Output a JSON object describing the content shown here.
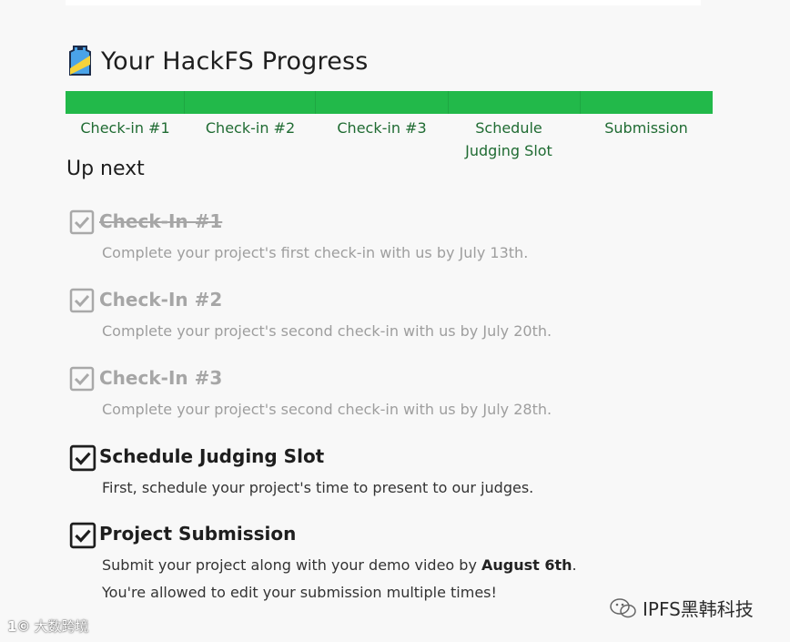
{
  "header": {
    "title": "Your HackFS Progress",
    "icon": "building-badge-icon"
  },
  "progress": {
    "steps": [
      {
        "label": "Check-in #1",
        "complete": true
      },
      {
        "label": "Check-in #2",
        "complete": true
      },
      {
        "label": "Check-in #3",
        "complete": true
      },
      {
        "label": "Schedule Judging Slot",
        "complete": true
      },
      {
        "label": "Submission",
        "complete": true
      }
    ],
    "color": "#22b94a"
  },
  "upnext": {
    "heading": "Up next"
  },
  "tasks": [
    {
      "title": "Check-In #1",
      "desc": "Complete your project's first check-in with us by July 13th.",
      "state": "done-struck"
    },
    {
      "title": "Check-In #2",
      "desc": "Complete your project's second check-in with us by July 20th.",
      "state": "done"
    },
    {
      "title": "Check-In #3",
      "desc": "Complete your project's second check-in with us by July 28th.",
      "state": "done"
    },
    {
      "title": "Schedule Judging Slot",
      "desc": "First, schedule your project's time to present to our judges.",
      "state": "active"
    },
    {
      "title": "Project Submission",
      "desc_pre": "Submit your project along with your demo video by ",
      "desc_bold": "August 6th",
      "desc_post": ".",
      "desc2": "You're allowed to edit your submission multiple times!",
      "state": "active"
    }
  ],
  "watermarks": {
    "left": "大数跨境",
    "right": "IPFS黑韩科技"
  }
}
